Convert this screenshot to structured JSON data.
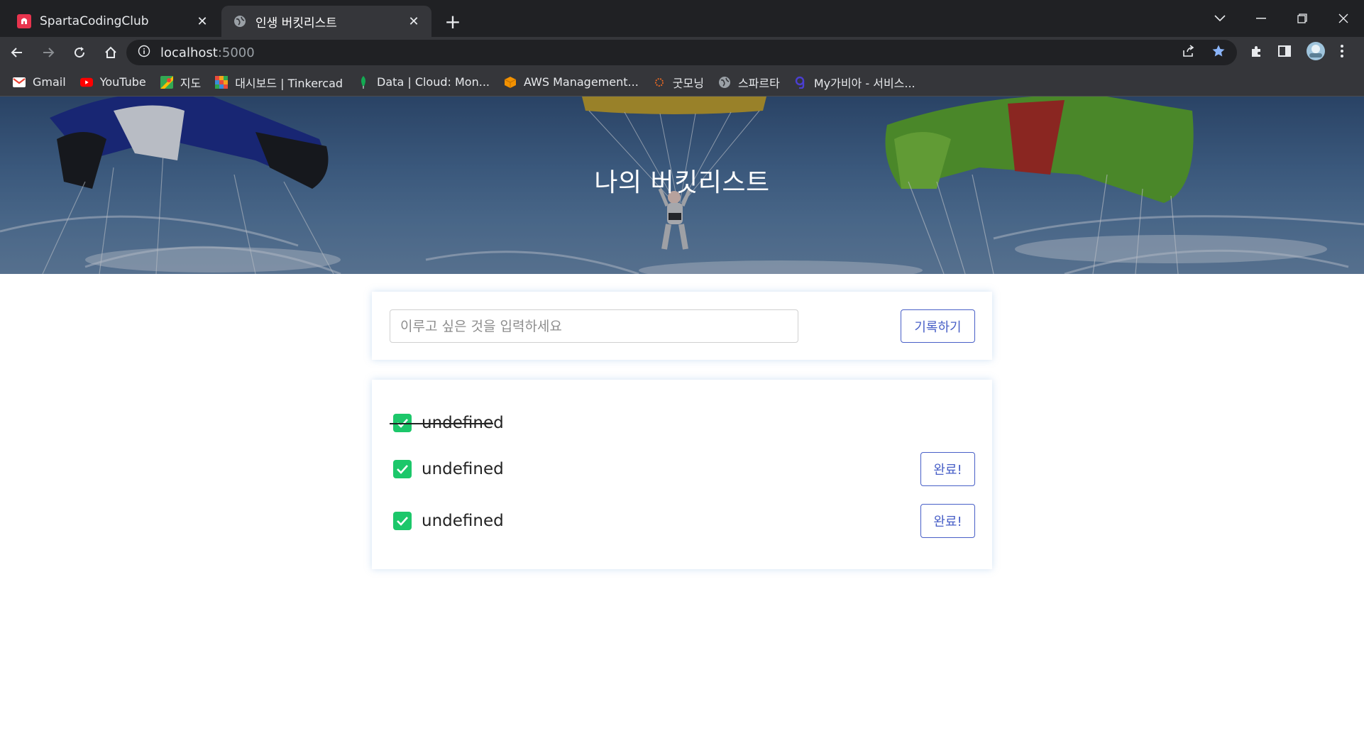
{
  "browser": {
    "tabs": [
      {
        "title": "SpartaCodingClub",
        "icon": "sparta-favicon",
        "active": false
      },
      {
        "title": "인생 버킷리스트",
        "icon": "globe-icon",
        "active": true
      }
    ],
    "address": {
      "host": "localhost",
      "port": ":5000"
    },
    "bookmarks": [
      {
        "label": "Gmail",
        "icon": "gmail-icon"
      },
      {
        "label": "YouTube",
        "icon": "youtube-icon"
      },
      {
        "label": "지도",
        "icon": "maps-icon"
      },
      {
        "label": "대시보드 | Tinkercad",
        "icon": "tinkercad-icon"
      },
      {
        "label": "Data | Cloud: Mon...",
        "icon": "mongodb-icon"
      },
      {
        "label": "AWS Management...",
        "icon": "aws-icon"
      },
      {
        "label": "굿모닝",
        "icon": "sun-icon"
      },
      {
        "label": "스파르타",
        "icon": "globe-icon"
      },
      {
        "label": "My가비아 - 서비스...",
        "icon": "gabia-icon"
      }
    ]
  },
  "page": {
    "hero_title": "나의 버킷리스트",
    "form": {
      "placeholder": "이루고 싶은 것을 입력하세요",
      "submit_label": "기록하기"
    },
    "items": [
      {
        "text": "undefined",
        "done": true
      },
      {
        "text": "undefined",
        "done": false,
        "button": "완료!"
      },
      {
        "text": "undefined",
        "done": false,
        "button": "완료!"
      }
    ]
  },
  "colors": {
    "accent": "#485fc7",
    "check": "#1cc76a"
  }
}
